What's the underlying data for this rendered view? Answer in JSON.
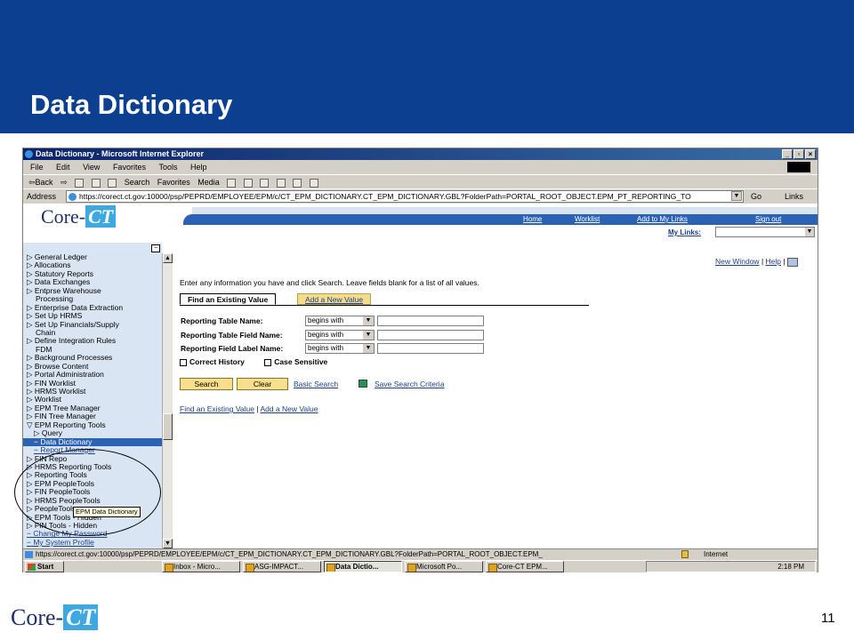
{
  "slide": {
    "title": "Data Dictionary",
    "page_number": "11",
    "logo_text_left": "Core-",
    "logo_text_right": "CT"
  },
  "browser": {
    "title": "Data Dictionary - Microsoft Internet Explorer",
    "window_buttons": [
      "_",
      "▫",
      "×"
    ],
    "menu": [
      "File",
      "Edit",
      "View",
      "Favorites",
      "Tools",
      "Help"
    ],
    "toolbar": {
      "back": "⇦Back",
      "forward": "⇨",
      "search": "Search",
      "favorites": "Favorites",
      "media": "Media"
    },
    "address_label": "Address",
    "address_url": "https://corect.ct.gov:10000/psp/PEPRD/EMPLOYEE/EPM/c/CT_EPM_DICTIONARY.CT_EPM_DICTIONARY.GBL?FolderPath=PORTAL_ROOT_OBJECT.EPM_PT_REPORTING_TO",
    "go_label": "Go",
    "links_label": "Links"
  },
  "portal": {
    "logo_left": "Core-",
    "logo_right": "CT",
    "nav_links": [
      "Home",
      "Worklist",
      "Add to My Links",
      "Sign out"
    ],
    "my_links_label": "My Links:"
  },
  "left_nav": {
    "collapse_icon": "−",
    "items": [
      {
        "label": "▷ General Ledger",
        "type": "item"
      },
      {
        "label": "▷ Allocations",
        "type": "item"
      },
      {
        "label": "▷ Statutory Reports",
        "type": "item"
      },
      {
        "label": "▷ Data Exchanges",
        "type": "item"
      },
      {
        "label": "▷ Entprse Warehouse",
        "type": "item"
      },
      {
        "label": "Processing",
        "type": "cont"
      },
      {
        "label": "▷ Enterprise Data Extraction",
        "type": "item"
      },
      {
        "label": "▷ Set Up HRMS",
        "type": "item"
      },
      {
        "label": "▷ Set Up Financials/Supply",
        "type": "item"
      },
      {
        "label": "Chain",
        "type": "cont"
      },
      {
        "label": "▷ Define Integration Rules",
        "type": "item"
      },
      {
        "label": "FDM",
        "type": "cont"
      },
      {
        "label": "▷ Background Processes",
        "type": "item"
      },
      {
        "label": "▷ Browse Content",
        "type": "item"
      },
      {
        "label": "▷ Portal Administration",
        "type": "item"
      },
      {
        "label": "▷ FIN Worklist",
        "type": "item"
      },
      {
        "label": "▷ HRMS Worklist",
        "type": "item"
      },
      {
        "label": "▷ Worklist",
        "type": "item"
      },
      {
        "label": "▷ EPM Tree Manager",
        "type": "item"
      },
      {
        "label": "▷ FIN Tree Manager",
        "type": "item"
      },
      {
        "label": "▽ EPM Reporting Tools",
        "type": "item"
      },
      {
        "label": "▷ Query",
        "type": "sub"
      },
      {
        "label": "− Data Dictionary",
        "type": "selected"
      },
      {
        "label": "− Report Manager",
        "type": "sublink"
      },
      {
        "label": "▷ FIN Repo",
        "type": "item"
      },
      {
        "label": "▷ HRMS Reporting Tools",
        "type": "item"
      },
      {
        "label": "▷ Reporting Tools",
        "type": "item"
      },
      {
        "label": "▷ EPM PeopleTools",
        "type": "item"
      },
      {
        "label": "▷ FIN PeopleTools",
        "type": "item"
      },
      {
        "label": "▷ HRMS PeopleTools",
        "type": "item"
      },
      {
        "label": "▷ PeopleTools",
        "type": "item"
      },
      {
        "label": "▷ EPM Tools - Hidden",
        "type": "item"
      },
      {
        "label": "▷ FIN Tools - Hidden",
        "type": "item"
      },
      {
        "label": "− Change My Password",
        "type": "link"
      },
      {
        "label": "− My System Profile",
        "type": "link"
      }
    ],
    "tooltip": "EPM Data Dictionary"
  },
  "main": {
    "new_window": "New Window",
    "help": "Help",
    "separator": "|",
    "intro": "Enter any information you have and click Search. Leave fields blank for a list of all values.",
    "tabs": {
      "active": "Find an Existing Value",
      "inactive": "Add a New Value"
    },
    "fields": [
      {
        "label": "Reporting Table Name:",
        "operator": "begins with",
        "value": ""
      },
      {
        "label": "Reporting Table Field Name:",
        "operator": "begins with",
        "value": ""
      },
      {
        "label": "Reporting Field Label Name:",
        "operator": "begins with",
        "value": ""
      }
    ],
    "checkboxes": [
      "Correct History",
      "Case Sensitive"
    ],
    "search_button": "Search",
    "clear_button": "Clear",
    "basic_search": "Basic Search",
    "save_search": "Save Search Criteria",
    "bottom_link_1": "Find an Existing Value",
    "bottom_link_2": "Add a New Value"
  },
  "status": {
    "url": "https://corect.ct.gov:10000/psp/PEPRD/EMPLOYEE/EPM/c/CT_EPM_DICTIONARY.CT_EPM_DICTIONARY.GBL?FolderPath=PORTAL_ROOT_OBJECT.EPM_",
    "zone": "Internet"
  },
  "taskbar": {
    "start": "Start",
    "tasks": [
      {
        "label": "Inbox - Micro...",
        "active": false
      },
      {
        "label": "ASG-IMPACT...",
        "active": false
      },
      {
        "label": "Data Dictio...",
        "active": true
      },
      {
        "label": "Microsoft Po...",
        "active": false
      },
      {
        "label": "Core-CT EPM...",
        "active": false
      }
    ],
    "clock": "2:18 PM"
  }
}
